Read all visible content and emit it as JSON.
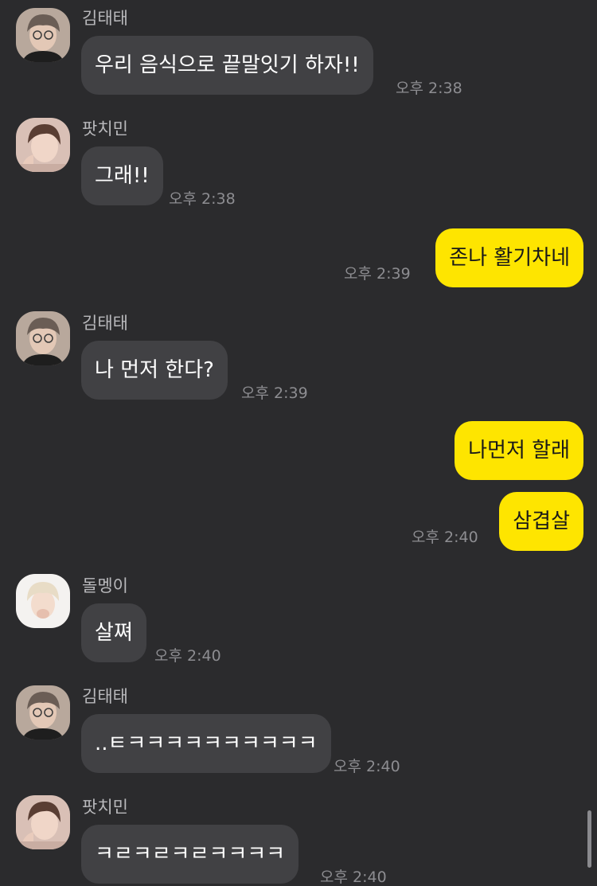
{
  "chat": {
    "messages": [
      {
        "sender": "김태태",
        "text": "우리 음식으로 끝말잇기 하자!!",
        "time": "오후 2:38"
      },
      {
        "sender": "팟치민",
        "text": "그래!!",
        "time": "오후 2:38"
      },
      {
        "text": "존나 활기차네",
        "time": "오후 2:39"
      },
      {
        "sender": "김태태",
        "text": "나 먼저 한다?",
        "time": "오후 2:39"
      },
      {
        "text": "나먼저 할래"
      },
      {
        "text": "삼겹살",
        "time": "오후 2:40"
      },
      {
        "sender": "돌멩이",
        "text": "살쪄",
        "time": "오후 2:40"
      },
      {
        "sender": "김태태",
        "text": "..ㅌㅋㅋㅋㅋㅋㅋㅋㅋㅋㅋ",
        "time": "오후 2:40"
      },
      {
        "sender": "팟치민",
        "text": "ㅋㄹㅋㄹㅋㄹㅋㅋㅋㅋ",
        "time": "오후 2:40"
      }
    ]
  },
  "colors": {
    "background": "#2b2b2d",
    "incoming_bubble": "#414144",
    "outgoing_bubble": "#fee500",
    "sender_name": "#b9b9bc",
    "timestamp": "#8d8d91"
  },
  "icons": {
    "avatar_kimtaetae": "profile-photo-avatar",
    "avatar_patchimin": "profile-photo-avatar",
    "avatar_dolmengi": "profile-photo-avatar"
  }
}
